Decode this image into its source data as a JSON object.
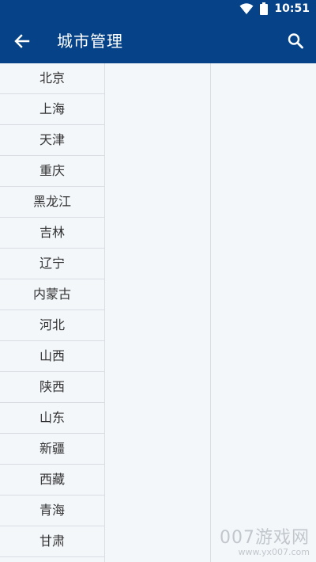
{
  "status_bar": {
    "time": "10:51",
    "icons": [
      "wifi-icon",
      "battery-icon"
    ]
  },
  "toolbar": {
    "title": "城市管理",
    "back_icon": "arrow-left-icon",
    "search_icon": "search-icon"
  },
  "provinces": [
    "北京",
    "上海",
    "天津",
    "重庆",
    "黑龙江",
    "吉林",
    "辽宁",
    "内蒙古",
    "河北",
    "山西",
    "陕西",
    "山东",
    "新疆",
    "西藏",
    "青海",
    "甘肃"
  ],
  "watermark": {
    "main": "007游戏网",
    "sub": "www.yx007.com"
  },
  "colors": {
    "primary": "#054287",
    "background": "#f3f7fa",
    "divider": "#d8dee4",
    "text": "#333333"
  }
}
